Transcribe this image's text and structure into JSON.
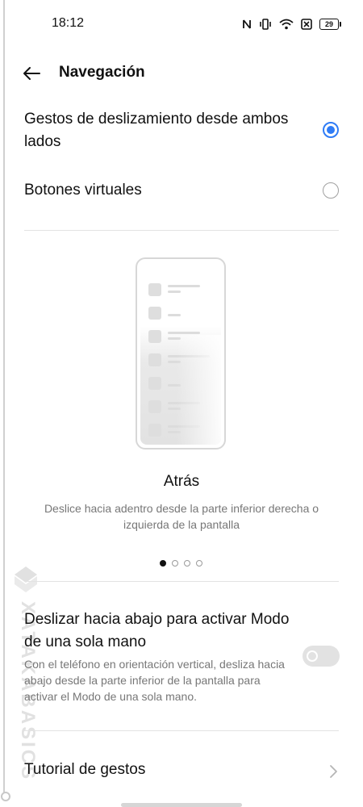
{
  "status_bar": {
    "time": "18:12",
    "battery": "29",
    "icons": [
      "nfc-icon",
      "vibrate-icon",
      "wifi-icon",
      "sim-off-icon",
      "battery-icon"
    ]
  },
  "header": {
    "title": "Navegación",
    "back_icon": "arrow-left-icon"
  },
  "options": [
    {
      "label": "Gestos de deslizamiento desde ambos lados",
      "selected": true
    },
    {
      "label": "Botones virtuales",
      "selected": false
    }
  ],
  "gesture_preview": {
    "title": "Atrás",
    "description": "Deslice hacia adentro desde la parte inferior derecha o izquierda de la pantalla",
    "pages": 4,
    "active_page": 1
  },
  "one_hand": {
    "title": "Deslizar hacia abajo para activar Modo de una sola mano",
    "description": "Con el teléfono en orientación vertical, desliza hacia abajo desde la parte inferior de la pantalla para activar el Modo de una sola mano.",
    "enabled": false
  },
  "tutorial": {
    "label": "Tutorial de gestos"
  },
  "watermark": {
    "text": "XATAKABASICS"
  },
  "colors": {
    "accent": "#2f7cf6",
    "text": "#111111",
    "secondary_text": "#777777",
    "divider": "#e3e3e3"
  }
}
